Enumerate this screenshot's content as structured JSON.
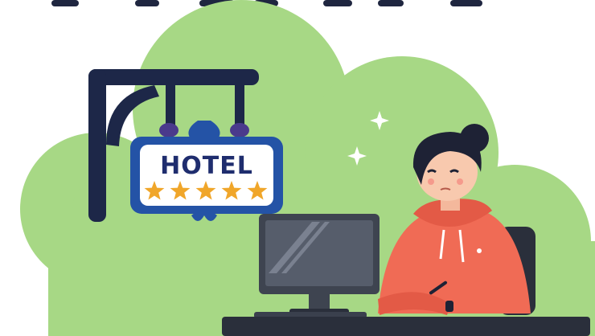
{
  "sign": {
    "label": "HOTEL",
    "star_rating": 5
  },
  "colors": {
    "cloud": "#a7d885",
    "bracket": "#1d2748",
    "sign_frame": "#2453a6",
    "star": "#f0a62a",
    "hoodie": "#f06b55",
    "monitor": "#3e4450",
    "desk": "#2a2f3b"
  },
  "icons": [
    "hanging-hotel-sign-icon",
    "star-icon",
    "sparkle-icon",
    "monitor-icon"
  ]
}
